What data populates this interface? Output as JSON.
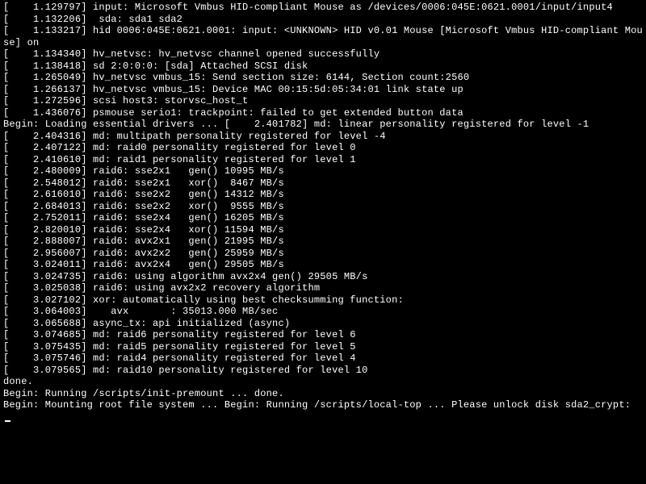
{
  "console": {
    "lines": [
      "[    1.129797] input: Microsoft Vmbus HID-compliant Mouse as /devices/0006:045E:0621.0001/input/input4",
      "[    1.132206]  sda: sda1 sda2",
      "[    1.133217] hid 0006:045E:0621.0001: input: <UNKNOWN> HID v0.01 Mouse [Microsoft Vmbus HID-compliant Mouse] on",
      "[    1.134340] hv_netvsc: hv_netvsc channel opened successfully",
      "[    1.138418] sd 2:0:0:0: [sda] Attached SCSI disk",
      "[    1.265049] hv_netvsc vmbus_15: Send section size: 6144, Section count:2560",
      "[    1.266137] hv_netvsc vmbus_15: Device MAC 00:15:5d:05:34:01 link state up",
      "[    1.272596] scsi host3: storvsc_host_t",
      "[    1.436076] psmouse serio1: trackpoint: failed to get extended button data",
      "Begin: Loading essential drivers ... [    2.401782] md: linear personality registered for level -1",
      "[    2.404316] md: multipath personality registered for level -4",
      "[    2.407122] md: raid0 personality registered for level 0",
      "[    2.410610] md: raid1 personality registered for level 1",
      "[    2.480009] raid6: sse2x1   gen() 10995 MB/s",
      "[    2.548012] raid6: sse2x1   xor()  8467 MB/s",
      "[    2.616010] raid6: sse2x2   gen() 14312 MB/s",
      "[    2.684013] raid6: sse2x2   xor()  9555 MB/s",
      "[    2.752011] raid6: sse2x4   gen() 16205 MB/s",
      "[    2.820010] raid6: sse2x4   xor() 11594 MB/s",
      "[    2.888007] raid6: avx2x1   gen() 21995 MB/s",
      "[    2.956007] raid6: avx2x2   gen() 25959 MB/s",
      "[    3.024011] raid6: avx2x4   gen() 29505 MB/s",
      "[    3.024735] raid6: using algorithm avx2x4 gen() 29505 MB/s",
      "[    3.025038] raid6: using avx2x2 recovery algorithm",
      "[    3.027102] xor: automatically using best checksumming function:",
      "[    3.064003]    avx       : 35013.000 MB/sec",
      "[    3.065688] async_tx: api initialized (async)",
      "[    3.074685] md: raid6 personality registered for level 6",
      "[    3.075435] md: raid5 personality registered for level 5",
      "[    3.075746] md: raid4 personality registered for level 4",
      "[    3.079565] md: raid10 personality registered for level 10",
      "done.",
      "Begin: Running /scripts/init-premount ... done.",
      "Begin: Mounting root file system ... Begin: Running /scripts/local-top ... Please unlock disk sda2_crypt: "
    ]
  }
}
